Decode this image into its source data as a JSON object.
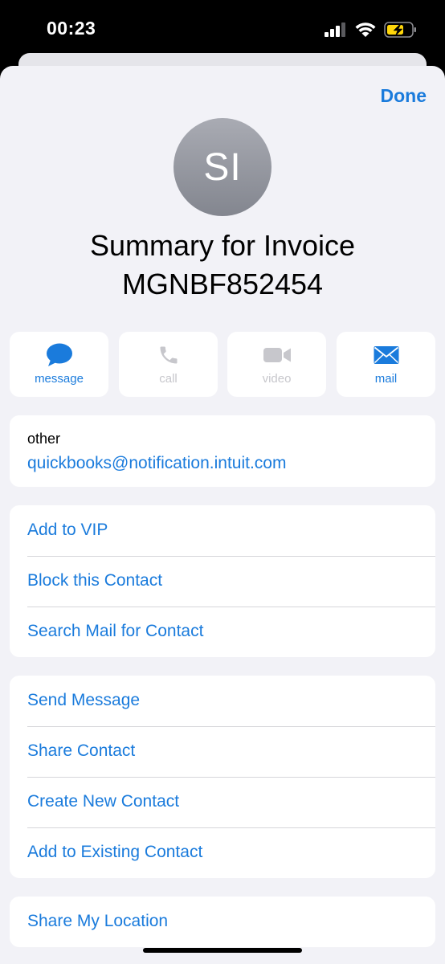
{
  "status_bar": {
    "time": "00:23"
  },
  "header": {
    "done_label": "Done"
  },
  "contact": {
    "initials": "SI",
    "name_line1": "Summary for Invoice",
    "name_line2": "MGNBF852454"
  },
  "actions": [
    {
      "label": "message",
      "icon": "message-bubble-icon",
      "enabled": true
    },
    {
      "label": "call",
      "icon": "phone-icon",
      "enabled": false
    },
    {
      "label": "video",
      "icon": "video-camera-icon",
      "enabled": false
    },
    {
      "label": "mail",
      "icon": "envelope-icon",
      "enabled": true
    }
  ],
  "info": {
    "label": "other",
    "value": "quickbooks@notification.intuit.com"
  },
  "menu1": [
    "Add to VIP",
    "Block this Contact",
    "Search Mail for Contact"
  ],
  "menu2": [
    "Send Message",
    "Share Contact",
    "Create New Contact",
    "Add to Existing Contact"
  ],
  "menu3": [
    "Share My Location"
  ],
  "colors": {
    "accent": "#1a7bdc",
    "background": "#f2f2f7",
    "disabled": "#c7c7cc",
    "battery": "#ffd60a"
  }
}
